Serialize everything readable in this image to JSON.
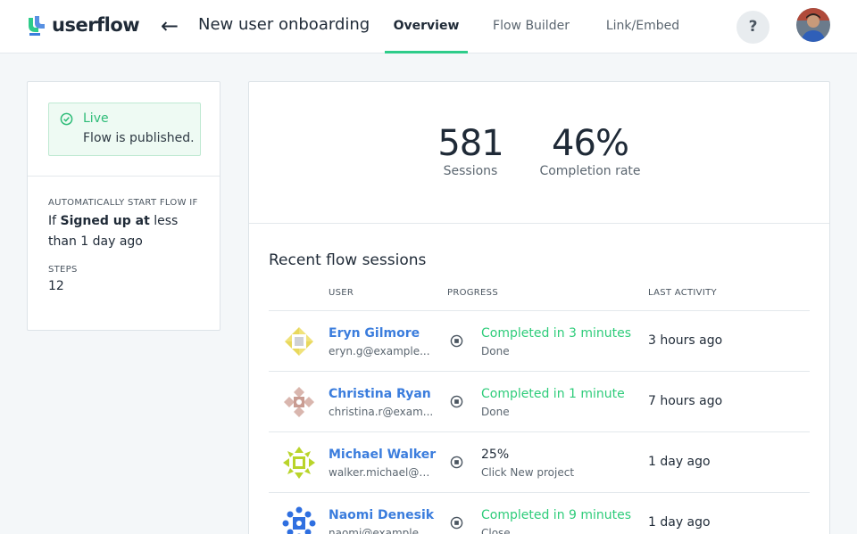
{
  "app": {
    "logo_text": "userflow",
    "flow_title": "New user onboarding",
    "brand_color": "#2ecc8a",
    "link_color": "#3b7ddd"
  },
  "tabs": [
    {
      "label": "Overview",
      "active": true
    },
    {
      "label": "Flow Builder",
      "active": false
    },
    {
      "label": "Link/Embed",
      "active": false
    }
  ],
  "header": {
    "back_icon": "arrow-left-icon",
    "help_label": "?"
  },
  "status": {
    "label": "Live",
    "description": "Flow is published."
  },
  "trigger": {
    "heading": "Automatically start flow if",
    "prefix": "If",
    "condition": "Signed up at",
    "rest": "less than 1 day ago"
  },
  "steps": {
    "heading": "Steps",
    "value": "12"
  },
  "stats": {
    "sessions_value": "581",
    "sessions_label": "Sessions",
    "rate_value": "46%",
    "rate_label": "Completion rate"
  },
  "sessions": {
    "title": "Recent flow sessions",
    "columns": {
      "user": "User",
      "progress": "Progress",
      "activity": "Last activity"
    },
    "rows": [
      {
        "name": "Eryn Gilmore",
        "email": "eryn.g@example...",
        "progress": "Completed in 3 minutes",
        "step": "Done",
        "activity": "3 hours ago",
        "completed": true,
        "avatar_color": "#f0e27a"
      },
      {
        "name": "Christina Ryan",
        "email": "christina.r@exam...",
        "progress": "Completed in 1 minute",
        "step": "Done",
        "activity": "7 hours ago",
        "completed": true,
        "avatar_color": "#d9b6ae"
      },
      {
        "name": "Michael Walker",
        "email": "walker.michael@e...",
        "progress": "25%",
        "step": "Click New project",
        "activity": "1 day ago",
        "completed": false,
        "avatar_color": "#b9d42a"
      },
      {
        "name": "Naomi Denesik",
        "email": "naomi@example...",
        "progress": "Completed in 9 minutes",
        "step": "Close",
        "activity": "1 day ago",
        "completed": true,
        "avatar_color": "#2f6fe0"
      }
    ]
  }
}
